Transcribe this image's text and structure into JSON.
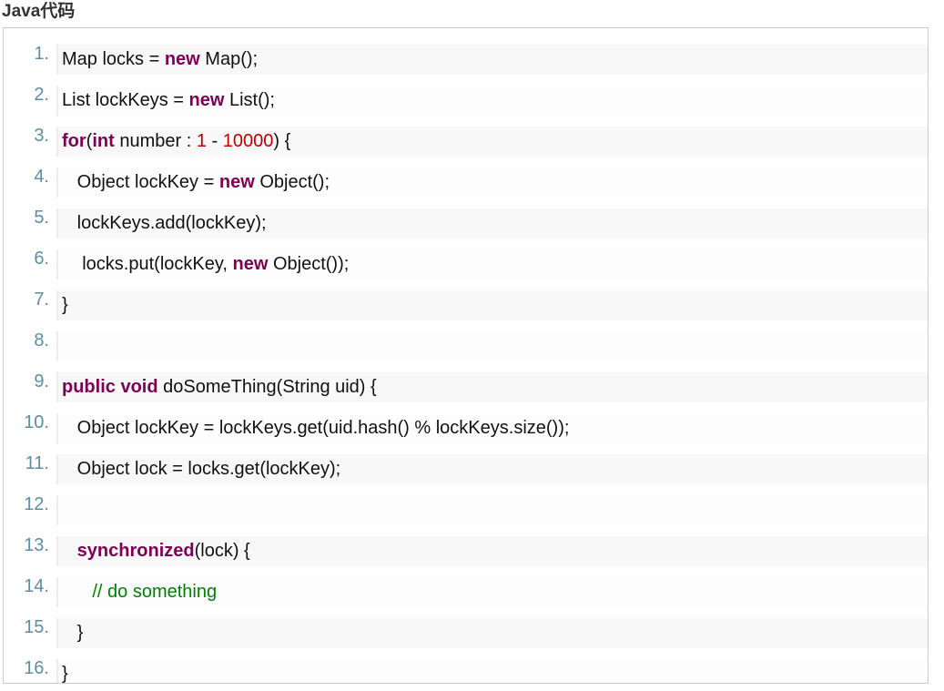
{
  "code_block": {
    "title": "Java代码",
    "lines": [
      {
        "number": "1.",
        "tokens": [
          {
            "text": "Map locks = ",
            "style": "plain"
          },
          {
            "text": "new",
            "style": "keyword"
          },
          {
            "text": " Map();",
            "style": "plain"
          }
        ]
      },
      {
        "number": "2.",
        "tokens": [
          {
            "text": "List lockKeys = ",
            "style": "plain"
          },
          {
            "text": "new",
            "style": "keyword"
          },
          {
            "text": " List();",
            "style": "plain"
          }
        ]
      },
      {
        "number": "3.",
        "tokens": [
          {
            "text": "for",
            "style": "keyword"
          },
          {
            "text": "(",
            "style": "plain"
          },
          {
            "text": "int",
            "style": "keyword"
          },
          {
            "text": " number : ",
            "style": "plain"
          },
          {
            "text": "1",
            "style": "number"
          },
          {
            "text": " - ",
            "style": "plain"
          },
          {
            "text": "10000",
            "style": "number"
          },
          {
            "text": ") {",
            "style": "plain"
          }
        ]
      },
      {
        "number": "4.",
        "tokens": [
          {
            "text": "   Object lockKey = ",
            "style": "plain"
          },
          {
            "text": "new",
            "style": "keyword"
          },
          {
            "text": " Object();",
            "style": "plain"
          }
        ]
      },
      {
        "number": "5.",
        "tokens": [
          {
            "text": "   lockKeys.add(lockKey);",
            "style": "plain"
          }
        ]
      },
      {
        "number": "6.",
        "tokens": [
          {
            "text": "    locks.put(lockKey, ",
            "style": "plain"
          },
          {
            "text": "new",
            "style": "keyword"
          },
          {
            "text": " Object());",
            "style": "plain"
          }
        ]
      },
      {
        "number": "7.",
        "tokens": [
          {
            "text": "}",
            "style": "plain"
          }
        ]
      },
      {
        "number": "8.",
        "tokens": []
      },
      {
        "number": "9.",
        "tokens": [
          {
            "text": "public",
            "style": "keyword"
          },
          {
            "text": " ",
            "style": "plain"
          },
          {
            "text": "void",
            "style": "keyword"
          },
          {
            "text": " doSomeThing(String uid) {",
            "style": "plain"
          }
        ]
      },
      {
        "number": "10.",
        "tokens": [
          {
            "text": "   Object lockKey = lockKeys.get(uid.hash() % lockKeys.size());",
            "style": "plain"
          }
        ]
      },
      {
        "number": "11.",
        "tokens": [
          {
            "text": "   Object lock = locks.get(lockKey);",
            "style": "plain"
          }
        ]
      },
      {
        "number": "12.",
        "tokens": []
      },
      {
        "number": "13.",
        "tokens": [
          {
            "text": "   ",
            "style": "plain"
          },
          {
            "text": "synchronized",
            "style": "keyword"
          },
          {
            "text": "(lock) {",
            "style": "plain"
          }
        ]
      },
      {
        "number": "14.",
        "tokens": [
          {
            "text": "      ",
            "style": "plain"
          },
          {
            "text": "// do something",
            "style": "comment"
          }
        ]
      },
      {
        "number": "15.",
        "tokens": [
          {
            "text": "   }",
            "style": "plain"
          }
        ]
      },
      {
        "number": "16.",
        "tokens": [
          {
            "text": "}",
            "style": "plain"
          }
        ]
      }
    ]
  },
  "colors": {
    "keyword": "#7f0055",
    "number": "#c00000",
    "comment": "#008200",
    "line_number": "#5c8ea6",
    "text": "#111111"
  }
}
